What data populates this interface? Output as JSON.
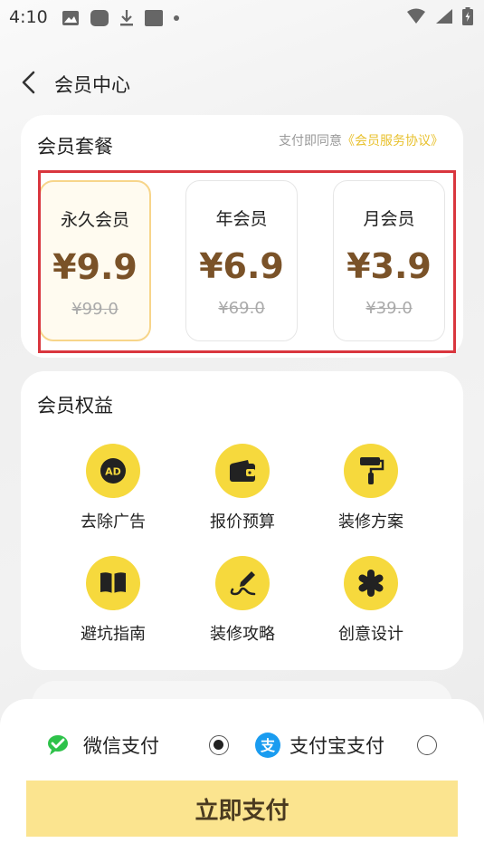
{
  "status_bar": {
    "time": "4:10"
  },
  "nav": {
    "title": "会员中心"
  },
  "plans_section": {
    "title": "会员套餐",
    "agreement_prefix": "支付即同意",
    "agreement_link": "《会员服务协议》",
    "plans": [
      {
        "name": "永久会员",
        "price": "¥9.9",
        "original_price": "¥99.0",
        "selected": true
      },
      {
        "name": "年会员",
        "price": "¥6.9",
        "original_price": "¥69.0",
        "selected": false
      },
      {
        "name": "月会员",
        "price": "¥3.9",
        "original_price": "¥39.0",
        "selected": false
      }
    ]
  },
  "benefits_section": {
    "title": "会员权益",
    "items": [
      {
        "label": "去除广告",
        "icon": "ad-icon"
      },
      {
        "label": "报价预算",
        "icon": "wallet-icon"
      },
      {
        "label": "装修方案",
        "icon": "paint-roller-icon"
      },
      {
        "label": "避坑指南",
        "icon": "book-icon"
      },
      {
        "label": "装修攻略",
        "icon": "pen-icon"
      },
      {
        "label": "创意设计",
        "icon": "asterisk-icon"
      }
    ]
  },
  "payment": {
    "options": [
      {
        "label": "微信支付",
        "icon": "wechat-icon",
        "selected": true
      },
      {
        "label": "支付宝支付",
        "icon": "alipay-icon",
        "selected": false
      }
    ],
    "pay_button": "立即支付"
  },
  "colors": {
    "accent_yellow": "#f6d93d",
    "price_brown": "#7a5228",
    "button_yellow": "#fbe48f",
    "highlight_red": "#d9363e"
  }
}
